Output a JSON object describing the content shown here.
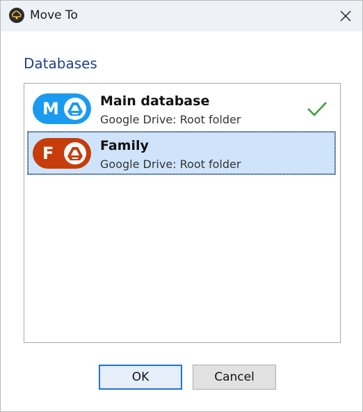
{
  "window": {
    "title": "Move To",
    "app_icon": "cloud-key-icon",
    "close_icon": "close-icon"
  },
  "section": {
    "label": "Databases"
  },
  "databases": [
    {
      "letter": "M",
      "name": "Main database",
      "location": "Google Drive: Root folder",
      "color": "#1a9bf0",
      "icon": "google-drive-icon",
      "current": true,
      "selected": false
    },
    {
      "letter": "F",
      "name": "Family",
      "location": "Google Drive: Root folder",
      "color": "#c63c0a",
      "icon": "google-drive-icon",
      "current": false,
      "selected": true
    }
  ],
  "buttons": {
    "ok_label": "OK",
    "cancel_label": "Cancel"
  },
  "colors": {
    "accent": "#1e73d6",
    "check": "#3aa042",
    "selection": "#cfe4fb"
  }
}
